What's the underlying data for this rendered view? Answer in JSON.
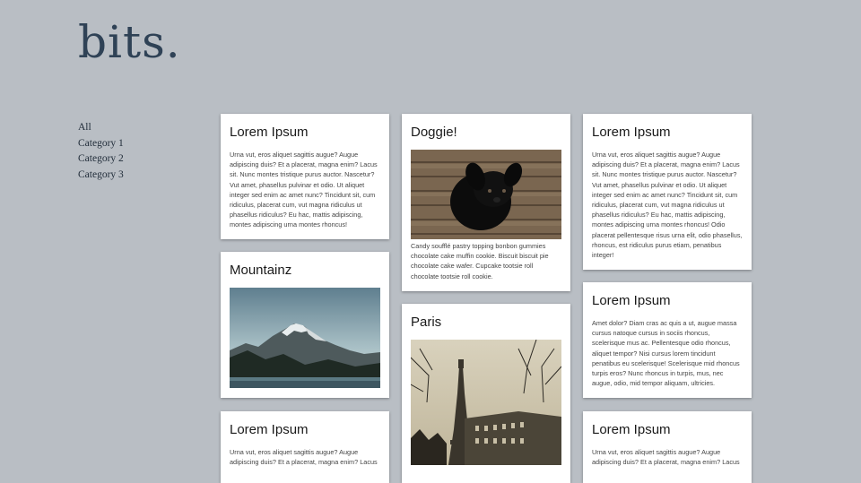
{
  "site": {
    "logo": "bits."
  },
  "nav": [
    "All",
    "Category 1",
    "Category 2",
    "Category 3"
  ],
  "cards": {
    "c1": {
      "title": "Lorem Ipsum",
      "text": "Urna vut, eros aliquet sagittis augue? Augue adipiscing duis? Et a placerat, magna enim? Lacus sit. Nunc montes tristique purus auctor. Nascetur? Vut amet, phasellus pulvinar et odio. Ut aliquet integer sed enim ac amet nunc? Tincidunt sit, cum ridiculus, placerat cum, vut magna ridiculus ut phasellus ridiculus? Eu hac, mattis adipiscing, montes adipiscing urna montes rhoncus!"
    },
    "c2": {
      "title": "Mountainz"
    },
    "c3": {
      "title": "Lorem Ipsum",
      "text": "Urna vut, eros aliquet sagittis augue? Augue adipiscing duis? Et a placerat, magna enim? Lacus"
    },
    "c4": {
      "title": "Doggie!",
      "text": "Candy soufflé pastry topping bonbon gummies chocolate cake muffin cookie. Biscuit biscuit pie chocolate cake wafer. Cupcake tootsie roll chocolate tootsie roll cookie."
    },
    "c5": {
      "title": "Paris"
    },
    "c6": {
      "title": "Lorem Ipsum",
      "text": "Urna vut, eros aliquet sagittis augue? Augue adipiscing duis? Et a placerat, magna enim? Lacus sit. Nunc montes tristique purus auctor. Nascetur? Vut amet, phasellus pulvinar et odio. Ut aliquet integer sed enim ac amet nunc? Tincidunt sit, cum ridiculus, placerat cum, vut magna ridiculus ut phasellus ridiculus? Eu hac, mattis adipiscing, montes adipiscing urna montes rhoncus! Odio placerat pellentesque risus urna elit, odio phasellus, rhoncus, est ridiculus purus etiam, penatibus integer!"
    },
    "c7": {
      "title": "Lorem Ipsum",
      "text": "Amet dolor? Diam cras ac quis a ut, augue massa cursus natoque cursus in sociis rhoncus, scelerisque mus ac. Pellentesque odio rhoncus, aliquet tempor? Nisi cursus lorem tincidunt penatibus eu scelerisque! Scelerisque mid rhoncus turpis eros? Nunc rhoncus in turpis, mus, nec augue, odio, mid tempor aliquam, ultricies."
    },
    "c8": {
      "title": "Lorem Ipsum",
      "text": "Urna vut, eros aliquet sagittis augue? Augue adipiscing duis? Et a placerat, magna enim? Lacus"
    }
  },
  "icons": {
    "mountain": "mountain-photo-icon",
    "dog": "dog-photo-icon",
    "paris": "paris-photo-icon"
  }
}
